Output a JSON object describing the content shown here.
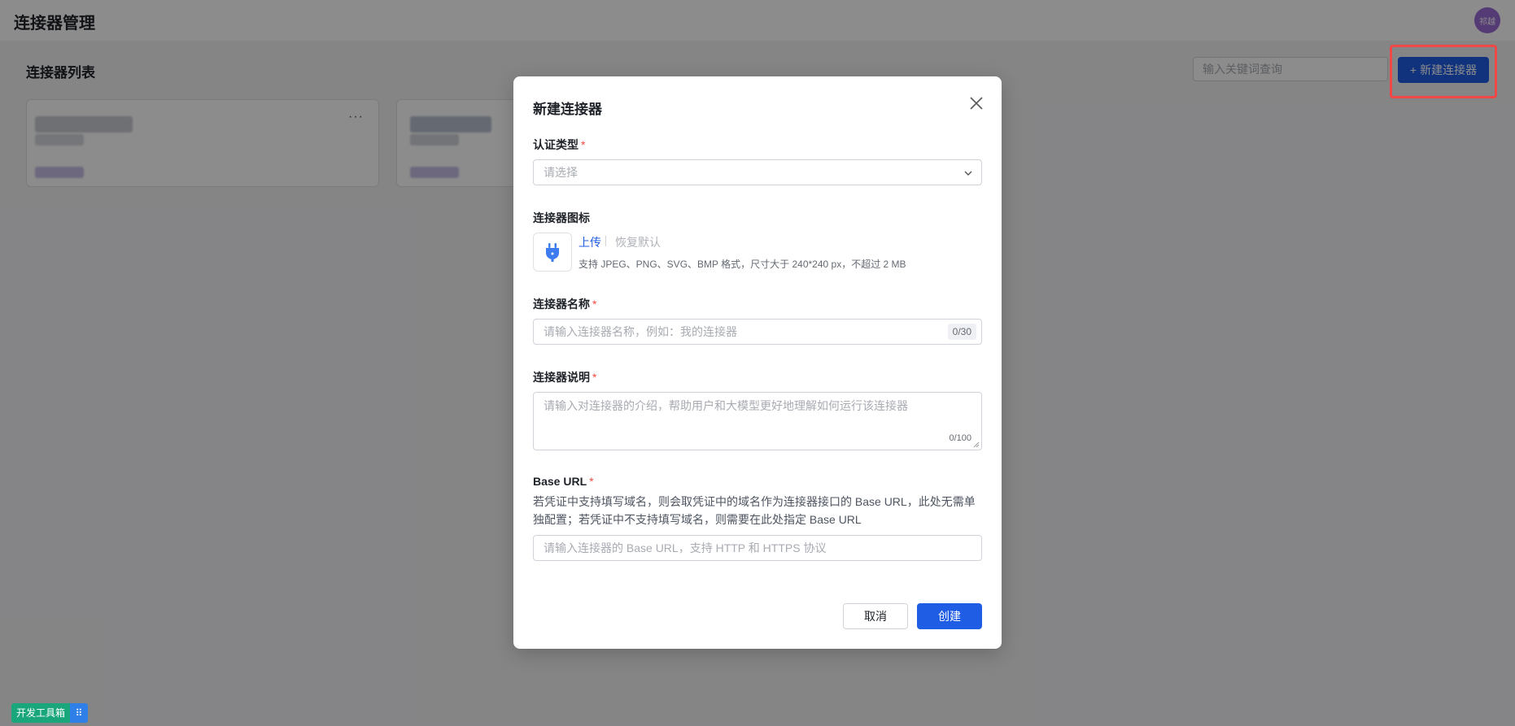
{
  "app": {
    "title": "连接器管理",
    "avatar_text": "祁越"
  },
  "list": {
    "title": "连接器列表",
    "search_placeholder": "输入关键词查询",
    "new_button_label": "新建连接器",
    "new_button_icon": "plus-icon"
  },
  "colors": {
    "primary": "#1f5de4",
    "required": "#f54a45",
    "highlight": "#f04747",
    "devtools_green": "#19a67a"
  },
  "devtools": {
    "label": "开发工具箱",
    "grip_icon": "⠿"
  },
  "modal": {
    "title": "新建连接器",
    "close_icon": "close-icon",
    "auth_type": {
      "label": "认证类型",
      "required_mark": "*",
      "placeholder": "请选择"
    },
    "icon": {
      "label": "连接器图标",
      "upload_label": "上传",
      "restore_label": "恢复默认",
      "hint": "支持 JPEG、PNG、SVG、BMP 格式，尺寸大于 240*240 px，不超过 2 MB",
      "icon_name": "plug-icon"
    },
    "name": {
      "label": "连接器名称",
      "required_mark": "*",
      "placeholder": "请输入连接器名称，例如：我的连接器",
      "counter": "0/30"
    },
    "description": {
      "label": "连接器说明",
      "required_mark": "*",
      "placeholder": "请输入对连接器的介绍，帮助用户和大模型更好地理解如何运行该连接器",
      "counter": "0/100"
    },
    "base_url": {
      "label": "Base URL",
      "required_mark": "*",
      "description": "若凭证中支持填写域名，则会取凭证中的域名作为连接器接口的 Base URL，此处无需单独配置；若凭证中不支持填写域名，则需要在此处指定 Base URL",
      "placeholder": "请输入连接器的 Base URL，支持 HTTP 和 HTTPS 协议"
    },
    "cancel_label": "取消",
    "create_label": "创建"
  }
}
